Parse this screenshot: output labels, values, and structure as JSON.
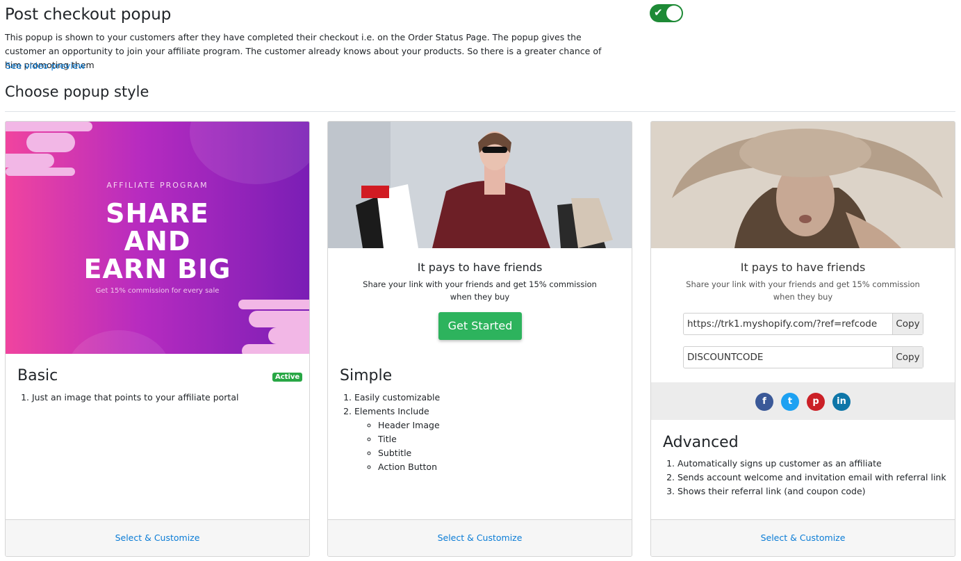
{
  "header": {
    "title": "Post checkout popup",
    "description": "This popup is shown to your customers after they have completed their checkout i.e. on the Order Status Page. The popup gives the customer an opportunity to join your affiliate program. The customer already knows about your products. So there is a greater chance of him promoting them",
    "video_link": "See video preview",
    "toggle_on": true
  },
  "section_title": "Choose popup style",
  "colors": {
    "accent": "#0a7cd6",
    "toggle": "#1e8a36",
    "badge": "#28a745",
    "cta": "#2db35d"
  },
  "cards": [
    {
      "name": "Basic",
      "badge": "Active",
      "image": {
        "kicker": "AFFILIATE PROGRAM",
        "line1": "SHARE",
        "line2": "AND",
        "line3": "EARN BIG",
        "caption": "Get 15% commission for every sale"
      },
      "features": [
        "Just an image that points to your affiliate portal"
      ],
      "footer": "Select & Customize"
    },
    {
      "name": "Simple",
      "popup_title": "It pays to have friends",
      "popup_sub_line1": "Share your link with your friends and get 15% commission",
      "popup_sub_line2": "when they buy",
      "button": "Get Started",
      "features": [
        "Easily customizable",
        "Elements Include"
      ],
      "elements": [
        "Header Image",
        "Title",
        "Subtitle",
        "Action Button"
      ],
      "footer": "Select & Customize"
    },
    {
      "name": "Advanced",
      "popup_title": "It pays to have friends",
      "popup_sub_line1": "Share your link with your friends and get 15% commission",
      "popup_sub_line2": "when they buy",
      "referral_link": "https://trk1.myshopify.com/?ref=refcode",
      "discount_code": "DISCOUNTCODE",
      "copy_label": "Copy",
      "social": [
        "facebook-icon",
        "twitter-icon",
        "pinterest-icon",
        "linkedin-icon"
      ],
      "features": [
        "Automatically signs up customer as an affiliate",
        "Sends account welcome and invitation email with referral link",
        "Shows their referral link (and coupon code)"
      ],
      "footer": "Select & Customize"
    }
  ]
}
